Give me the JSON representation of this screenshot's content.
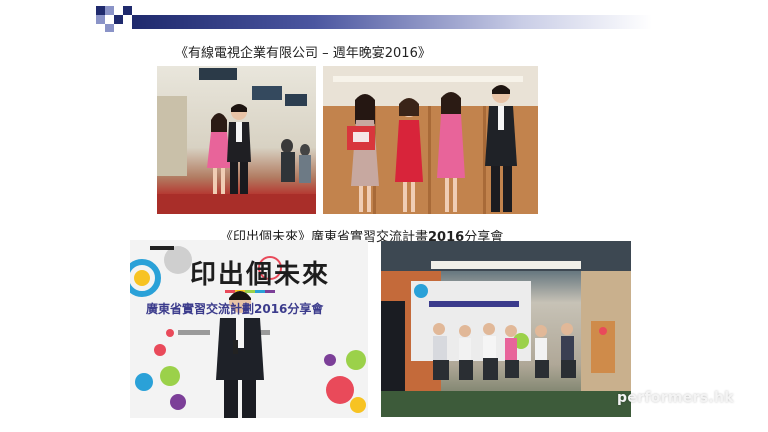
{
  "captions": {
    "top": "《有線電視企業有限公司 – 週年晚宴2016》",
    "middle_prefix": "《印出個未來》廣東省實習交流計畫",
    "middle_bold": "2016",
    "middle_suffix": "分享會"
  },
  "banner": {
    "title": "印出個未來",
    "subtitle": "廣東省實習交流計劃2016分享會"
  },
  "watermark": "performers.hk",
  "colors": {
    "header_bar": "#1f2a6d",
    "stage_red": "#b5322c",
    "pink_dress": "#e8649a",
    "red_dress": "#d8243a"
  }
}
